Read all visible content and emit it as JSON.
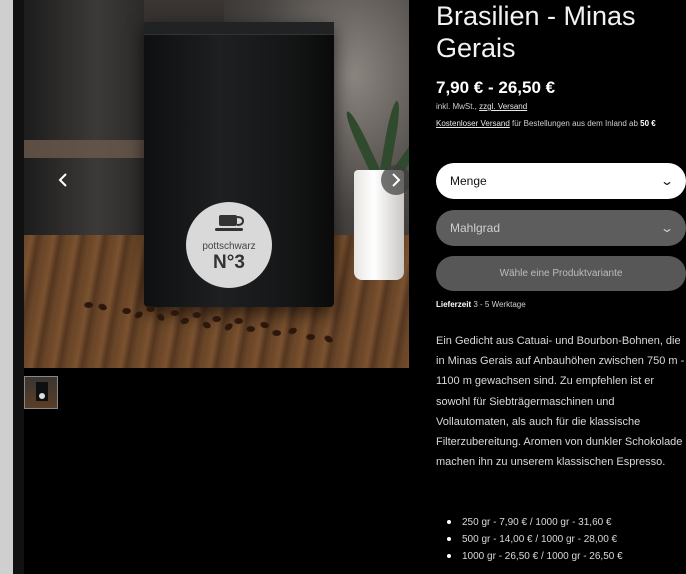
{
  "product": {
    "title": "Brasilien - Minas Gerais",
    "price": "7,90 € - 26,50 €",
    "tax_prefix": "inkl. MwSt.,",
    "tax_link": "zzgl. Versand",
    "shipping_link": "Kostenloser Versand",
    "shipping_text": " für Bestellungen aus dem Inland ab ",
    "shipping_threshold": "50 €"
  },
  "gallery": {
    "bag_brand": "pottschwarz",
    "bag_number": "N°3",
    "prev_icon": "chevron-left-icon",
    "next_icon": "chevron-right-icon"
  },
  "options": {
    "quantity_label": "Menge",
    "grind_label": "Mahlgrad",
    "choose_variant_label": "Wähle eine Produktvariante"
  },
  "delivery": {
    "label": "Lieferzeit",
    "value": " 3 - 5 Werktage"
  },
  "description": "Ein Gedicht aus Catuai- und Bourbon-Bohnen, die in Minas Gerais auf Anbauhöhen zwischen 750 m - 1100 m gewachsen sind. Zu empfehlen ist er sowohl für Siebträgermaschinen und Vollautomaten, als auch für die klassische Filterzubereitung. Aromen von dunkler Schokolade machen ihn zu unserem klassischen Espresso.",
  "price_list": [
    "250 gr -  7,90 € / 1000 gr - 31,60 €",
    "500 gr - 14,00 € / 1000 gr - 28,00 €",
    "1000 gr - 26,50 € / 1000 gr - 26,50 €"
  ],
  "colors": {
    "background": "#000000",
    "select_active": "#ffffff",
    "select_disabled": "#5d5d5d",
    "button_disabled": "#575757"
  }
}
